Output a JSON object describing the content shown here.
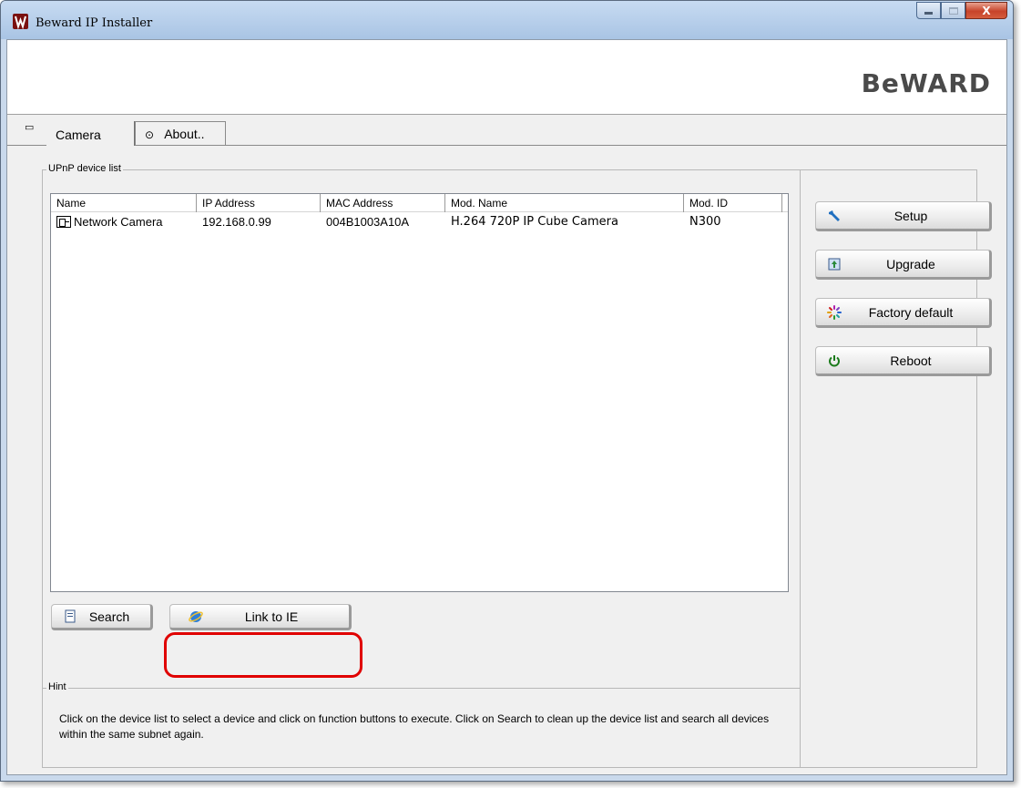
{
  "window": {
    "title": "Beward IP Installer",
    "close_glyph": "X",
    "brand": "BeWARD"
  },
  "tabs": [
    {
      "label": "Camera",
      "icon": "camera-tab-icon",
      "active": true
    },
    {
      "label": "About..",
      "icon": "info-icon",
      "active": false
    }
  ],
  "device_list": {
    "group_label": "UPnP device list",
    "columns": [
      "Name",
      "IP Address",
      "MAC Address",
      "Mod. Name",
      "Mod. ID"
    ],
    "rows": [
      {
        "name": "Network Camera",
        "ip": "192.168.0.99",
        "mac": "004B1003A10A",
        "mod_name": "H.264 720P IP Cube Camera",
        "mod_id": "N300"
      }
    ]
  },
  "buttons": {
    "search": "Search",
    "link_ie": "Link to IE",
    "setup": "Setup",
    "upgrade": "Upgrade",
    "factory_default": "Factory default",
    "reboot": "Reboot"
  },
  "hint": {
    "label": "Hint",
    "text": "Click on the device list to select a device and click on function buttons to execute. Click on Search to clean up the device list and search all devices  within the same subnet again."
  },
  "colors": {
    "highlight": "#e00000",
    "titlebar": "#b9cfea",
    "close_button": "#c7432a"
  }
}
